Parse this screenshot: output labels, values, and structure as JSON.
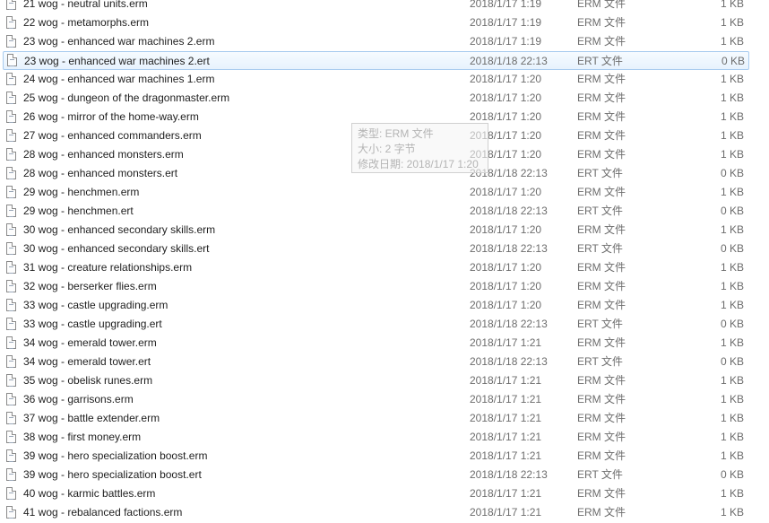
{
  "files": [
    {
      "name": "21 wog - neutral units.erm",
      "date": "2018/1/17 1:19",
      "type": "ERM 文件",
      "size": "1 KB"
    },
    {
      "name": "22 wog - metamorphs.erm",
      "date": "2018/1/17 1:19",
      "type": "ERM 文件",
      "size": "1 KB"
    },
    {
      "name": "23 wog - enhanced war machines 2.erm",
      "date": "2018/1/17 1:19",
      "type": "ERM 文件",
      "size": "1 KB"
    },
    {
      "name": "23 wog - enhanced war machines 2.ert",
      "date": "2018/1/18 22:13",
      "type": "ERT 文件",
      "size": "0 KB",
      "selected": true
    },
    {
      "name": "24 wog - enhanced war machines 1.erm",
      "date": "2018/1/17 1:20",
      "type": "ERM 文件",
      "size": "1 KB"
    },
    {
      "name": "25 wog - dungeon of the dragonmaster.erm",
      "date": "2018/1/17 1:20",
      "type": "ERM 文件",
      "size": "1 KB"
    },
    {
      "name": "26 wog - mirror of the home-way.erm",
      "date": "2018/1/17 1:20",
      "type": "ERM 文件",
      "size": "1 KB"
    },
    {
      "name": "27 wog - enhanced commanders.erm",
      "date": "2018/1/17 1:20",
      "type": "ERM 文件",
      "size": "1 KB"
    },
    {
      "name": "28 wog - enhanced monsters.erm",
      "date": "2018/1/17 1:20",
      "type": "ERM 文件",
      "size": "1 KB"
    },
    {
      "name": "28 wog - enhanced monsters.ert",
      "date": "2018/1/18 22:13",
      "type": "ERT 文件",
      "size": "0 KB"
    },
    {
      "name": "29 wog - henchmen.erm",
      "date": "2018/1/17 1:20",
      "type": "ERM 文件",
      "size": "1 KB"
    },
    {
      "name": "29 wog - henchmen.ert",
      "date": "2018/1/18 22:13",
      "type": "ERT 文件",
      "size": "0 KB"
    },
    {
      "name": "30 wog - enhanced secondary skills.erm",
      "date": "2018/1/17 1:20",
      "type": "ERM 文件",
      "size": "1 KB"
    },
    {
      "name": "30 wog - enhanced secondary skills.ert",
      "date": "2018/1/18 22:13",
      "type": "ERT 文件",
      "size": "0 KB"
    },
    {
      "name": "31 wog - creature relationships.erm",
      "date": "2018/1/17 1:20",
      "type": "ERM 文件",
      "size": "1 KB"
    },
    {
      "name": "32 wog - berserker flies.erm",
      "date": "2018/1/17 1:20",
      "type": "ERM 文件",
      "size": "1 KB"
    },
    {
      "name": "33 wog - castle upgrading.erm",
      "date": "2018/1/17 1:20",
      "type": "ERM 文件",
      "size": "1 KB"
    },
    {
      "name": "33 wog - castle upgrading.ert",
      "date": "2018/1/18 22:13",
      "type": "ERT 文件",
      "size": "0 KB"
    },
    {
      "name": "34 wog - emerald tower.erm",
      "date": "2018/1/17 1:21",
      "type": "ERM 文件",
      "size": "1 KB"
    },
    {
      "name": "34 wog - emerald tower.ert",
      "date": "2018/1/18 22:13",
      "type": "ERT 文件",
      "size": "0 KB"
    },
    {
      "name": "35 wog - obelisk runes.erm",
      "date": "2018/1/17 1:21",
      "type": "ERM 文件",
      "size": "1 KB"
    },
    {
      "name": "36 wog - garrisons.erm",
      "date": "2018/1/17 1:21",
      "type": "ERM 文件",
      "size": "1 KB"
    },
    {
      "name": "37 wog - battle extender.erm",
      "date": "2018/1/17 1:21",
      "type": "ERM 文件",
      "size": "1 KB"
    },
    {
      "name": "38 wog - first money.erm",
      "date": "2018/1/17 1:21",
      "type": "ERM 文件",
      "size": "1 KB"
    },
    {
      "name": "39 wog - hero specialization boost.erm",
      "date": "2018/1/17 1:21",
      "type": "ERM 文件",
      "size": "1 KB"
    },
    {
      "name": "39 wog - hero specialization boost.ert",
      "date": "2018/1/18 22:13",
      "type": "ERT 文件",
      "size": "0 KB"
    },
    {
      "name": "40 wog - karmic battles.erm",
      "date": "2018/1/17 1:21",
      "type": "ERM 文件",
      "size": "1 KB"
    },
    {
      "name": "41 wog - rebalanced factions.erm",
      "date": "2018/1/17 1:21",
      "type": "ERM 文件",
      "size": "1 KB"
    }
  ],
  "tooltip": {
    "type_line": "类型: ERM 文件",
    "size_line": "大小: 2 字节",
    "modified_line": "修改日期: 2018/1/17 1:20"
  },
  "icon": "text-file-icon",
  "colors": {
    "selection_bg": "#e7f2fd",
    "selection_border": "#a8cbef",
    "meta_text": "#6d6d6d"
  }
}
